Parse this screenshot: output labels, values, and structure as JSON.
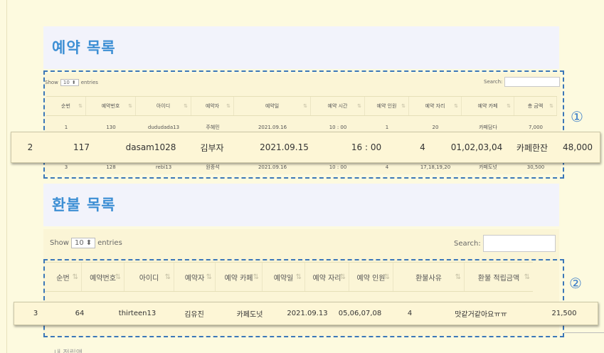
{
  "reservations": {
    "title": "예약 목록",
    "show_label": "Show",
    "entries_value": "10",
    "entries_label": "entries",
    "search_label": "Search:",
    "columns": [
      "순번",
      "예약번호",
      "아이디",
      "예약자",
      "예약일",
      "예약 시간",
      "예약 인원",
      "예약 자리",
      "예약 카페",
      "총 금액"
    ],
    "rows": [
      [
        "1",
        "130",
        "dududada13",
        "주혜민",
        "2021.09.16",
        "10 : 00",
        "1",
        "20",
        "카페담다",
        "7,000"
      ],
      [
        "3",
        "128",
        "rebi13",
        "원종석",
        "2021.09.16",
        "10 : 00",
        "4",
        "17,18,19,20",
        "카페도넛",
        "30,500"
      ]
    ],
    "highlight": [
      "2",
      "117",
      "dasam1028",
      "김부자",
      "2021.09.15",
      "16 : 00",
      "4",
      "01,02,03,04",
      "카페한잔",
      "48,000"
    ],
    "badge": "①"
  },
  "refunds": {
    "title": "환불 목록",
    "show_label": "Show",
    "entries_value": "10",
    "entries_label": "entries",
    "search_label": "Search:",
    "columns": [
      "순번",
      "예약번호",
      "아이디",
      "예약자",
      "예약 카페",
      "예약일",
      "예약 자리",
      "예약 인원",
      "환불사유",
      "환불 적립금액"
    ],
    "highlight": [
      "3",
      "64",
      "thirteen13",
      "김유진",
      "카페도넛",
      "2021.09.13",
      "05,06,07,08",
      "4",
      "맛같거같아요ㅠㅠ",
      "21,500"
    ],
    "badge": "②"
  },
  "footer_text": "내 적립액"
}
